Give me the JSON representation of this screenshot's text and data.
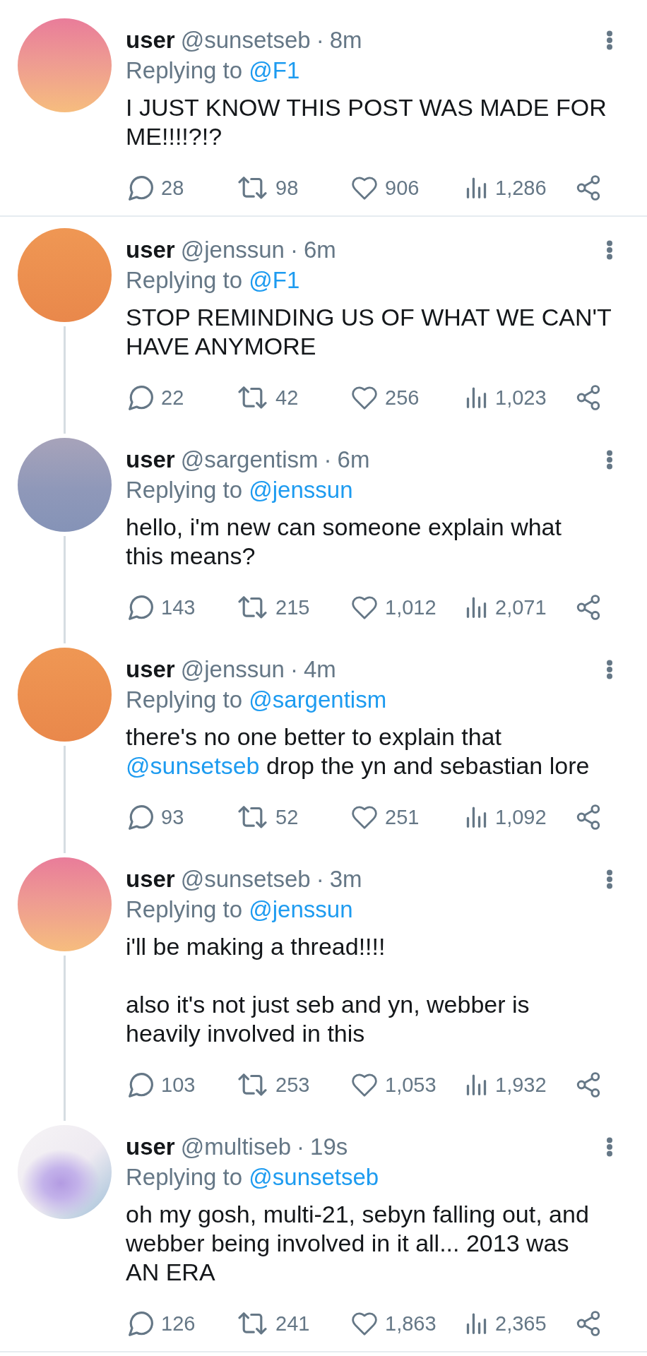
{
  "conversations": [
    {
      "tweets": [
        {
          "avatar": {
            "kind": "sunset"
          },
          "name": "user",
          "handle": "@sunsetseb",
          "separator": "·",
          "time": "8m",
          "reply_label": "Replying to",
          "reply_to": "@F1",
          "paragraphs": [
            [
              {
                "kind": "text",
                "text": "I JUST KNOW THIS POST WAS MADE FOR\nME!!!!?!?"
              }
            ]
          ],
          "actions": [
            {
              "kind": "reply",
              "count": "28"
            },
            {
              "kind": "retweet",
              "count": "98"
            },
            {
              "kind": "like",
              "count": "906"
            },
            {
              "kind": "views",
              "count": "1,286"
            },
            {
              "kind": "share"
            }
          ]
        }
      ]
    },
    {
      "tweets": [
        {
          "avatar": {
            "kind": "orange"
          },
          "name": "user",
          "handle": "@jenssun",
          "separator": "·",
          "time": "6m",
          "reply_label": "Replying to",
          "reply_to": "@F1",
          "paragraphs": [
            [
              {
                "kind": "text",
                "text": "STOP REMINDING US OF WHAT WE CAN'T\nHAVE ANYMORE"
              }
            ]
          ],
          "actions": [
            {
              "kind": "reply",
              "count": "22"
            },
            {
              "kind": "retweet",
              "count": "42"
            },
            {
              "kind": "like",
              "count": "256"
            },
            {
              "kind": "views",
              "count": "1,023"
            },
            {
              "kind": "share"
            }
          ]
        },
        {
          "avatar": {
            "kind": "slate"
          },
          "name": "user",
          "handle": "@sargentism",
          "separator": "·",
          "time": "6m",
          "reply_label": "Replying to",
          "reply_to": "@jenssun",
          "paragraphs": [
            [
              {
                "kind": "text",
                "text": "hello, i'm new can someone explain what\nthis means?"
              }
            ]
          ],
          "actions": [
            {
              "kind": "reply",
              "count": "143"
            },
            {
              "kind": "retweet",
              "count": "215"
            },
            {
              "kind": "like",
              "count": "1,012"
            },
            {
              "kind": "views",
              "count": "2,071"
            },
            {
              "kind": "share"
            }
          ]
        },
        {
          "avatar": {
            "kind": "orange"
          },
          "name": "user",
          "handle": "@jenssun",
          "separator": "·",
          "time": "4m",
          "reply_label": "Replying to",
          "reply_to": "@sargentism",
          "paragraphs": [
            [
              {
                "kind": "text",
                "text": "there's no one better to explain that\n"
              },
              {
                "kind": "mention",
                "text": "@sunsetseb"
              },
              {
                "kind": "text",
                "text": " drop the yn and sebastian lore"
              }
            ]
          ],
          "actions": [
            {
              "kind": "reply",
              "count": "93"
            },
            {
              "kind": "retweet",
              "count": "52"
            },
            {
              "kind": "like",
              "count": "251"
            },
            {
              "kind": "views",
              "count": "1,092"
            },
            {
              "kind": "share"
            }
          ]
        },
        {
          "avatar": {
            "kind": "sunset"
          },
          "name": "user",
          "handle": "@sunsetseb",
          "separator": "·",
          "time": "3m",
          "reply_label": "Replying to",
          "reply_to": "@jenssun",
          "paragraphs": [
            [
              {
                "kind": "text",
                "text": "i'll be making a thread!!!!"
              }
            ],
            [
              {
                "kind": "text",
                "text": "also it's not just seb and yn, webber is\nheavily involved in this"
              }
            ]
          ],
          "actions": [
            {
              "kind": "reply",
              "count": "103"
            },
            {
              "kind": "retweet",
              "count": "253"
            },
            {
              "kind": "like",
              "count": "1,053"
            },
            {
              "kind": "views",
              "count": "1,932"
            },
            {
              "kind": "share"
            }
          ]
        },
        {
          "avatar": {
            "kind": "pastel"
          },
          "name": "user",
          "handle": "@multiseb",
          "separator": "·",
          "time": "19s",
          "reply_label": "Replying to",
          "reply_to": "@sunsetseb",
          "paragraphs": [
            [
              {
                "kind": "text",
                "text": "oh my gosh, multi-21, sebyn falling out, and\nwebber being involved in it all... 2013 was\nAN ERA"
              }
            ]
          ],
          "actions": [
            {
              "kind": "reply",
              "count": "126"
            },
            {
              "kind": "retweet",
              "count": "241"
            },
            {
              "kind": "like",
              "count": "1,863"
            },
            {
              "kind": "views",
              "count": "2,365"
            },
            {
              "kind": "share"
            }
          ]
        }
      ]
    }
  ]
}
